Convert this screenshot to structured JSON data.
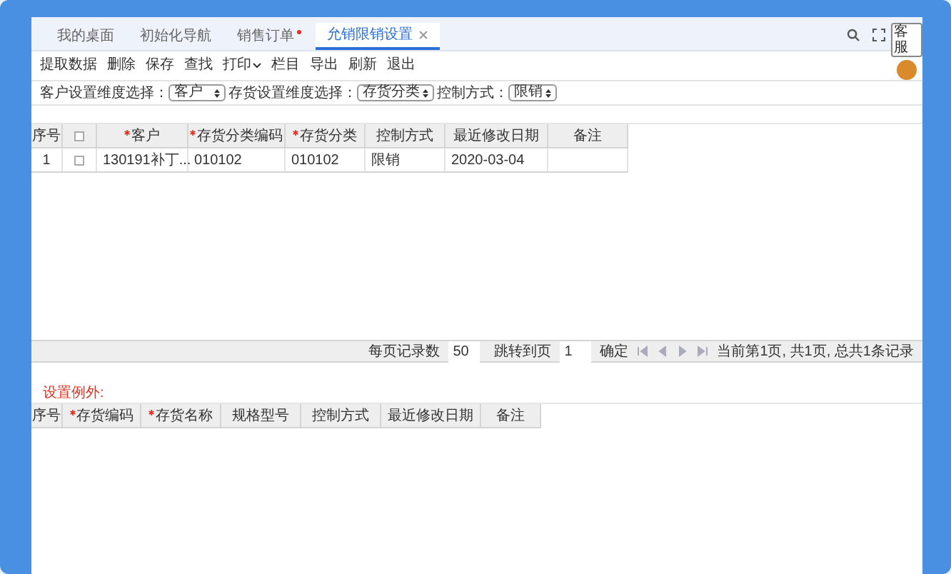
{
  "tabs": [
    {
      "label": "我的桌面",
      "selected": false,
      "modified": false
    },
    {
      "label": "初始化导航",
      "selected": false,
      "modified": false
    },
    {
      "label": "销售订单",
      "selected": false,
      "modified": true
    },
    {
      "label": "允销限销设置",
      "selected": true,
      "modified": false
    }
  ],
  "support_badge": "客服",
  "toolbar": [
    {
      "label": "提取数据",
      "dropdown": false
    },
    {
      "label": "删除",
      "dropdown": false
    },
    {
      "label": "保存",
      "dropdown": false
    },
    {
      "label": "查找",
      "dropdown": false
    },
    {
      "label": "打印",
      "dropdown": true
    },
    {
      "label": "栏目",
      "dropdown": false
    },
    {
      "label": "导出",
      "dropdown": false
    },
    {
      "label": "刷新",
      "dropdown": false
    },
    {
      "label": "退出",
      "dropdown": false
    }
  ],
  "filters": [
    {
      "label": "客户设置维度选择：",
      "value": "客户"
    },
    {
      "label": "存货设置维度选择：",
      "value": "存货分类"
    },
    {
      "label": "控制方式：",
      "value": "限销"
    }
  ],
  "table": {
    "all_checked": false,
    "columns": [
      {
        "label": "序号",
        "kind": "text",
        "required": false
      },
      {
        "kind": "checkbox"
      },
      {
        "label": "客户",
        "kind": "text",
        "required": true
      },
      {
        "label": "存货分类编码",
        "kind": "text",
        "required": true
      },
      {
        "label": "存货分类",
        "kind": "text",
        "required": true
      },
      {
        "label": "控制方式",
        "kind": "text",
        "required": false
      },
      {
        "label": "最近修改日期",
        "kind": "text",
        "required": false
      },
      {
        "label": "备注",
        "kind": "text",
        "required": false
      }
    ],
    "rows": [
      {
        "cells": [
          "1",
          "",
          "130191补丁...",
          "010102",
          "010102",
          "限销",
          "2020-03-04",
          ""
        ],
        "checked": false
      }
    ]
  },
  "pager": {
    "page_size_label": "每页记录数",
    "page_size": "50",
    "jump_label": "跳转到页",
    "jump_page": "1",
    "confirm": "确定",
    "summary": "当前第1页, 共1页, 总共1条记录"
  },
  "exceptions_title": "设置例外:",
  "exceptions_table": {
    "columns": [
      {
        "label": "序号",
        "required": false
      },
      {
        "label": "存货编码",
        "required": true
      },
      {
        "label": "存货名称",
        "required": true
      },
      {
        "label": "规格型号",
        "required": false
      },
      {
        "label": "控制方式",
        "required": false
      },
      {
        "label": "最近修改日期",
        "required": false
      },
      {
        "label": "备注",
        "required": false
      }
    ]
  }
}
